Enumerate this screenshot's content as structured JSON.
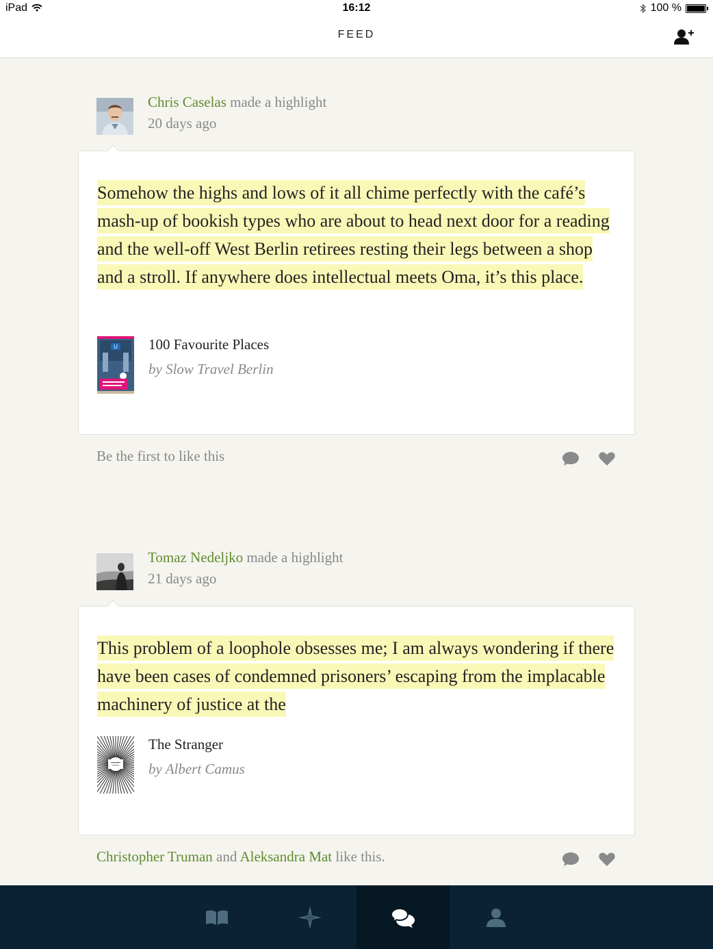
{
  "status_bar": {
    "device": "iPad",
    "time": "16:12",
    "battery": "100 %",
    "battery_level": 1.0
  },
  "nav": {
    "title": "FEED",
    "add_friend_icon": "add-person-icon"
  },
  "feed": [
    {
      "user": "Chris Caselas",
      "action": "made a highlight",
      "time_ago": "20 days ago",
      "quote": "Somehow the highs and lows of it all chime perfectly with the café’s mash-up of bookish types who are about to head next door for a reading and the well-off West Berlin retirees resting their legs between a shop and a stroll. If anywhere does intellectual meets Oma, it’s this place.",
      "book_title": "100 Favourite Places",
      "book_author": "by Slow Travel Berlin",
      "likes_text": "Be the first to like this"
    },
    {
      "user": "Tomaz Nedeljko",
      "action": "made a highlight",
      "time_ago": "21 days ago",
      "quote": "This problem of a loophole obsesses me; I am always wondering if there have been cases of condemned prisoners’ escaping from the implacable machinery of justice at the",
      "book_title": "The Stranger",
      "book_author": "by Albert Camus",
      "liker_1": "Christopher Truman",
      "likes_conj": "and",
      "liker_2": "Aleksandra Mat",
      "likes_suffix": "like this."
    }
  ],
  "tabs": [
    {
      "icon": "book-icon",
      "active": false
    },
    {
      "icon": "compass-star-icon",
      "active": false
    },
    {
      "icon": "chat-bubbles-icon",
      "active": true
    },
    {
      "icon": "profile-icon",
      "active": false
    }
  ],
  "colors": {
    "background": "#f5f4ee",
    "username": "#5f8c2e",
    "highlight": "#faf8b7",
    "tabbar": "#0a2233",
    "icon_gray": "#8a8a8a"
  }
}
